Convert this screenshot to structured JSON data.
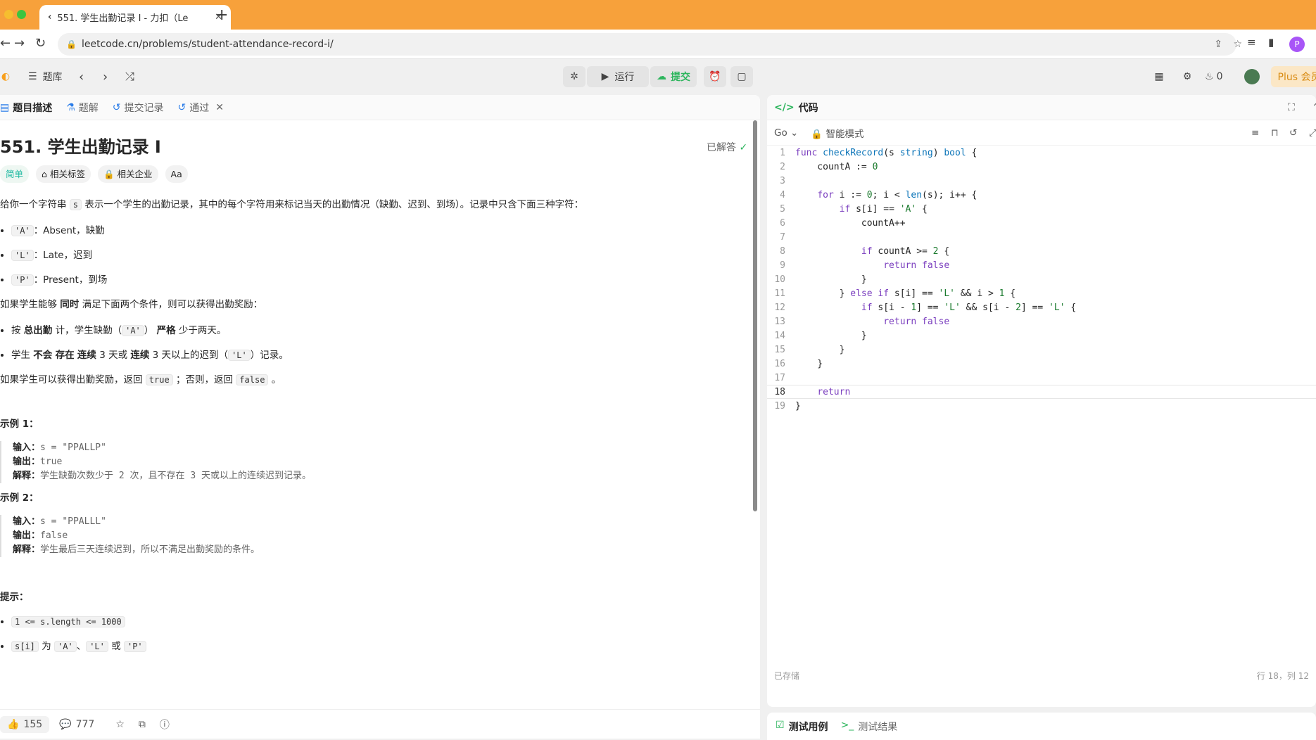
{
  "browser": {
    "tab_title": "551. 学生出勤记录 I - 力扣（Le",
    "url": "leetcode.cn/problems/student-attendance-record-i/",
    "profile_initial": "P",
    "colors": {
      "tabstrip": "#f7a13b",
      "profile": "#a855f7"
    }
  },
  "toolbar": {
    "problem_list": "题库",
    "run": "运行",
    "submit": "提交",
    "fire_count": "0",
    "plus": "Plus 会员"
  },
  "left_tabs": {
    "description": "题目描述",
    "solutions": "题解",
    "submissions": "提交记录",
    "accepted": "通过"
  },
  "problem": {
    "title": "551. 学生出勤记录 I",
    "solved": "已解答",
    "difficulty": "简单",
    "tags": "相关标签",
    "companies": "相关企业",
    "font_btn": "Aa",
    "intro_1": "给你一个字符串",
    "intro_code": "s",
    "intro_2": "表示一个学生的出勤记录，其中的每个字符用来标记当天的出勤情况（缺勤、迟到、到场）。记录中只含下面三种字符：",
    "chars": [
      {
        "code": "'A'",
        "text": "：Absent，缺勤"
      },
      {
        "code": "'L'",
        "text": "：Late，迟到"
      },
      {
        "code": "'P'",
        "text": "：Present，到场"
      }
    ],
    "cond_intro_1": "如果学生能够",
    "cond_intro_bold": "同时",
    "cond_intro_2": "满足下面两个条件，则可以获得出勤奖励：",
    "cond1_a": "按",
    "cond1_b": "总出勤",
    "cond1_c": "计，学生缺勤（",
    "cond1_code": "'A'",
    "cond1_d": "）",
    "cond1_e": "严格",
    "cond1_f": "少于两天。",
    "cond2_a": "学生",
    "cond2_b": "不会",
    "cond2_c": "存在",
    "cond2_d": "连续",
    "cond2_e": "3 天或",
    "cond2_f": "连续",
    "cond2_g": "3 天以上的迟到（",
    "cond2_code": "'L'",
    "cond2_h": "）记录。",
    "ret_1": "如果学生可以获得出勤奖励，返回",
    "ret_true": "true",
    "ret_2": "；否则，返回",
    "ret_false": "false",
    "ret_3": "。",
    "ex1_title": "示例 1：",
    "ex1_in_label": "输入：",
    "ex1_in": "s = \"PPALLP\"",
    "ex1_out_label": "输出：",
    "ex1_out": "true",
    "ex1_exp_label": "解释：",
    "ex1_exp": "学生缺勤次数少于 2 次，且不存在 3 天或以上的连续迟到记录。",
    "ex2_title": "示例 2：",
    "ex2_in_label": "输入：",
    "ex2_in": "s = \"PPALLL\"",
    "ex2_out_label": "输出：",
    "ex2_out": "false",
    "ex2_exp_label": "解释：",
    "ex2_exp": "学生最后三天连续迟到，所以不满足出勤奖励的条件。",
    "hint_title": "提示：",
    "hint1": "1 <= s.length <= 1000",
    "hint2_code": "s[i]",
    "hint2_a": "为",
    "hint2_c1": "'A'",
    "hint2_sep": "、",
    "hint2_c2": "'L'",
    "hint2_or": "或",
    "hint2_c3": "'P'"
  },
  "footer": {
    "likes": "155",
    "comments": "777"
  },
  "editor": {
    "title": "代码",
    "lang": "Go",
    "mode": "智能模式",
    "saved": "已存储",
    "cursor": "行 18，列 12",
    "lines": [
      "func checkRecord(s string) bool {",
      "    countA := 0",
      "",
      "    for i := 0; i < len(s); i++ {",
      "        if s[i] == 'A' {",
      "            countA++",
      "",
      "            if countA >= 2 {",
      "                return false",
      "            }",
      "        } else if s[i] == 'L' && i > 1 {",
      "            if s[i - 1] == 'L' && s[i - 2] == 'L' {",
      "                return false",
      "            }",
      "        }",
      "    }",
      "",
      "    return ",
      "}"
    ]
  },
  "bottom": {
    "testcase": "测试用例",
    "result": "测试结果"
  }
}
